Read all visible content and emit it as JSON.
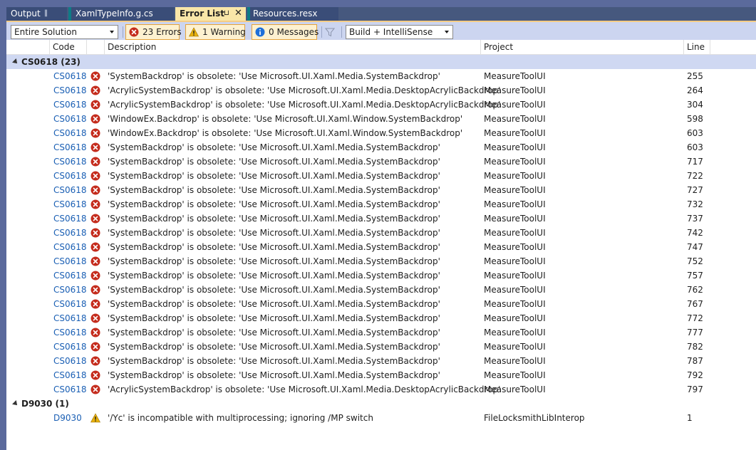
{
  "tabs": [
    {
      "label": "Output",
      "pin": "‖",
      "active": false
    },
    {
      "label": "XamlTypeInfo.g.cs",
      "active": false
    },
    {
      "label": "Error List",
      "pin": "⊔",
      "close": "✕",
      "active": true
    },
    {
      "label": "Resources.resx",
      "active": false
    }
  ],
  "toolbar": {
    "scope_value": "Entire Solution",
    "errors_label": "23 Errors",
    "warnings_label": "1 Warning",
    "messages_label": "0 Messages",
    "build_value": "Build + IntelliSense"
  },
  "columns": {
    "code": "Code",
    "description": "Description",
    "project": "Project",
    "line": "Line"
  },
  "groups": [
    {
      "label": "CS0618  (23)",
      "rows": [
        {
          "code": "CS0618",
          "severity": "error",
          "description": "'SystemBackdrop' is obsolete: 'Use Microsoft.UI.Xaml.Media.SystemBackdrop'",
          "project": "MeasureToolUI",
          "line": "255"
        },
        {
          "code": "CS0618",
          "severity": "error",
          "description": "'AcrylicSystemBackdrop' is obsolete: 'Use Microsoft.UI.Xaml.Media.DesktopAcrylicBackdrop'",
          "project": "MeasureToolUI",
          "line": "264"
        },
        {
          "code": "CS0618",
          "severity": "error",
          "description": "'AcrylicSystemBackdrop' is obsolete: 'Use Microsoft.UI.Xaml.Media.DesktopAcrylicBackdrop'",
          "project": "MeasureToolUI",
          "line": "304"
        },
        {
          "code": "CS0618",
          "severity": "error",
          "description": "'WindowEx.Backdrop' is obsolete: 'Use Microsoft.UI.Xaml.Window.SystemBackdrop'",
          "project": "MeasureToolUI",
          "line": "598"
        },
        {
          "code": "CS0618",
          "severity": "error",
          "description": "'WindowEx.Backdrop' is obsolete: 'Use Microsoft.UI.Xaml.Window.SystemBackdrop'",
          "project": "MeasureToolUI",
          "line": "603"
        },
        {
          "code": "CS0618",
          "severity": "error",
          "description": "'SystemBackdrop' is obsolete: 'Use Microsoft.UI.Xaml.Media.SystemBackdrop'",
          "project": "MeasureToolUI",
          "line": "603"
        },
        {
          "code": "CS0618",
          "severity": "error",
          "description": "'SystemBackdrop' is obsolete: 'Use Microsoft.UI.Xaml.Media.SystemBackdrop'",
          "project": "MeasureToolUI",
          "line": "717"
        },
        {
          "code": "CS0618",
          "severity": "error",
          "description": "'SystemBackdrop' is obsolete: 'Use Microsoft.UI.Xaml.Media.SystemBackdrop'",
          "project": "MeasureToolUI",
          "line": "722"
        },
        {
          "code": "CS0618",
          "severity": "error",
          "description": "'SystemBackdrop' is obsolete: 'Use Microsoft.UI.Xaml.Media.SystemBackdrop'",
          "project": "MeasureToolUI",
          "line": "727"
        },
        {
          "code": "CS0618",
          "severity": "error",
          "description": "'SystemBackdrop' is obsolete: 'Use Microsoft.UI.Xaml.Media.SystemBackdrop'",
          "project": "MeasureToolUI",
          "line": "732"
        },
        {
          "code": "CS0618",
          "severity": "error",
          "description": "'SystemBackdrop' is obsolete: 'Use Microsoft.UI.Xaml.Media.SystemBackdrop'",
          "project": "MeasureToolUI",
          "line": "737"
        },
        {
          "code": "CS0618",
          "severity": "error",
          "description": "'SystemBackdrop' is obsolete: 'Use Microsoft.UI.Xaml.Media.SystemBackdrop'",
          "project": "MeasureToolUI",
          "line": "742"
        },
        {
          "code": "CS0618",
          "severity": "error",
          "description": "'SystemBackdrop' is obsolete: 'Use Microsoft.UI.Xaml.Media.SystemBackdrop'",
          "project": "MeasureToolUI",
          "line": "747"
        },
        {
          "code": "CS0618",
          "severity": "error",
          "description": "'SystemBackdrop' is obsolete: 'Use Microsoft.UI.Xaml.Media.SystemBackdrop'",
          "project": "MeasureToolUI",
          "line": "752"
        },
        {
          "code": "CS0618",
          "severity": "error",
          "description": "'SystemBackdrop' is obsolete: 'Use Microsoft.UI.Xaml.Media.SystemBackdrop'",
          "project": "MeasureToolUI",
          "line": "757"
        },
        {
          "code": "CS0618",
          "severity": "error",
          "description": "'SystemBackdrop' is obsolete: 'Use Microsoft.UI.Xaml.Media.SystemBackdrop'",
          "project": "MeasureToolUI",
          "line": "762"
        },
        {
          "code": "CS0618",
          "severity": "error",
          "description": "'SystemBackdrop' is obsolete: 'Use Microsoft.UI.Xaml.Media.SystemBackdrop'",
          "project": "MeasureToolUI",
          "line": "767"
        },
        {
          "code": "CS0618",
          "severity": "error",
          "description": "'SystemBackdrop' is obsolete: 'Use Microsoft.UI.Xaml.Media.SystemBackdrop'",
          "project": "MeasureToolUI",
          "line": "772"
        },
        {
          "code": "CS0618",
          "severity": "error",
          "description": "'SystemBackdrop' is obsolete: 'Use Microsoft.UI.Xaml.Media.SystemBackdrop'",
          "project": "MeasureToolUI",
          "line": "777"
        },
        {
          "code": "CS0618",
          "severity": "error",
          "description": "'SystemBackdrop' is obsolete: 'Use Microsoft.UI.Xaml.Media.SystemBackdrop'",
          "project": "MeasureToolUI",
          "line": "782"
        },
        {
          "code": "CS0618",
          "severity": "error",
          "description": "'SystemBackdrop' is obsolete: 'Use Microsoft.UI.Xaml.Media.SystemBackdrop'",
          "project": "MeasureToolUI",
          "line": "787"
        },
        {
          "code": "CS0618",
          "severity": "error",
          "description": "'SystemBackdrop' is obsolete: 'Use Microsoft.UI.Xaml.Media.SystemBackdrop'",
          "project": "MeasureToolUI",
          "line": "792"
        },
        {
          "code": "CS0618",
          "severity": "error",
          "description": "'AcrylicSystemBackdrop' is obsolete: 'Use Microsoft.UI.Xaml.Media.DesktopAcrylicBackdrop'",
          "project": "MeasureToolUI",
          "line": "797"
        }
      ]
    },
    {
      "label": "D9030  (1)",
      "rows": [
        {
          "code": "D9030",
          "severity": "warning",
          "description": "'/Yc' is incompatible with multiprocessing; ignoring /MP switch",
          "project": "FileLocksmithLibInterop",
          "line": "1"
        }
      ]
    }
  ],
  "colors": {
    "frame": "#5b6a9c",
    "toolbar_bg": "#ccd5f0",
    "active_tab": "#f9e6a8",
    "group_highlight": "#cfd8f2",
    "code_link": "#1a5fb4",
    "error_red": "#c42b1c",
    "warning_yellow": "#e8b10c",
    "info_blue": "#1e6fd9"
  }
}
